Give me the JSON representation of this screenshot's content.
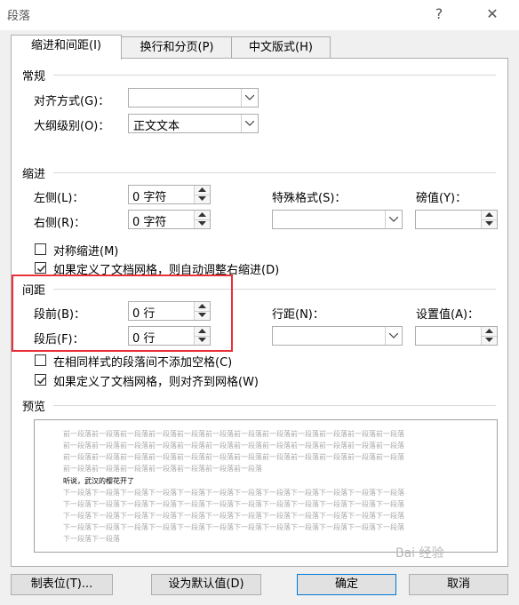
{
  "window": {
    "title": "段落",
    "help_label": "?",
    "close_label": "✕"
  },
  "tabs": [
    {
      "label": "缩进和间距(I)",
      "active": true
    },
    {
      "label": "换行和分页(P)",
      "active": false
    },
    {
      "label": "中文版式(H)",
      "active": false
    }
  ],
  "general": {
    "title": "常规",
    "alignment_label": "对齐方式(G)：",
    "alignment_value": "",
    "outline_label": "大纲级别(O)：",
    "outline_value": "正文文本"
  },
  "indent": {
    "title": "缩进",
    "left_label": "左侧(L)：",
    "left_value": "0 字符",
    "right_label": "右侧(R)：",
    "right_value": "0 字符",
    "special_label": "特殊格式(S)：",
    "special_value": "",
    "by_label": "磅值(Y)：",
    "by_value": "",
    "mirror_label": "对称缩进(M)",
    "mirror_checked": false,
    "auto_adjust_label": "如果定义了文档网格，则自动调整右缩进(D)",
    "auto_adjust_checked": true
  },
  "spacing": {
    "title": "间距",
    "before_label": "段前(B)：",
    "before_value": "0 行",
    "after_label": "段后(F)：",
    "after_value": "0 行",
    "line_label": "行距(N)：",
    "line_value": "",
    "at_label": "设置值(A)：",
    "at_value": "",
    "no_space_label": "在相同样式的段落间不添加空格(C)",
    "no_space_checked": false,
    "snap_grid_label": "如果定义了文档网格，则对齐到网格(W)",
    "snap_grid_checked": true
  },
  "preview": {
    "title": "预览",
    "prev_lines": [
      "前一段落前一段落前一段落前一段落前一段落前一段落前一段落前一段落前一段落前一段落前一段落前一段落",
      "前一段落前一段落前一段落前一段落前一段落前一段落前一段落前一段落前一段落前一段落前一段落前一段落",
      "前一段落前一段落前一段落前一段落前一段落前一段落前一段落前一段落前一段落前一段落前一段落前一段落",
      "前一段落前一段落前一段落前一段落前一段落前一段落前一段落"
    ],
    "current_line": "听说，武汉的樱花开了",
    "next_lines": [
      "下一段落下一段落下一段落下一段落下一段落下一段落下一段落下一段落下一段落下一段落下一段落下一段落",
      "下一段落下一段落下一段落下一段落下一段落下一段落下一段落下一段落下一段落下一段落下一段落下一段落",
      "下一段落下一段落下一段落下一段落下一段落下一段落下一段落下一段落下一段落下一段落下一段落下一段落",
      "下一段落下一段落下一段落下一段落下一段落下一段落下一段落下一段落下一段落下一段落下一段落下一段落",
      "下一段落下一段落"
    ]
  },
  "buttons": {
    "tabs_label": "制表位(T)...",
    "default_label": "设为默认值(D)",
    "ok_label": "确定",
    "cancel_label": "取消"
  },
  "watermark": "Bai 经验"
}
